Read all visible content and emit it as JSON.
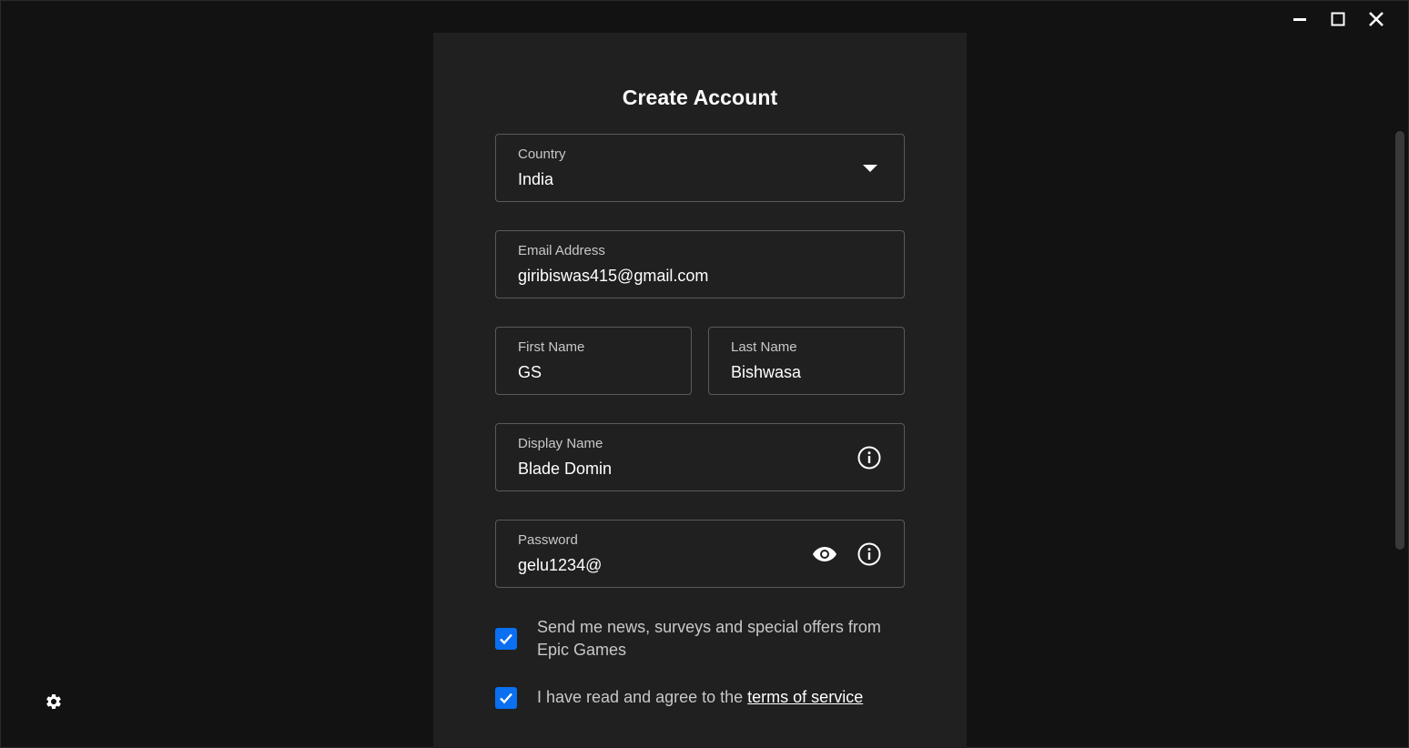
{
  "form": {
    "title": "Create Account",
    "country": {
      "label": "Country",
      "value": "India"
    },
    "email": {
      "label": "Email Address",
      "value": "giribiswas415@gmail.com"
    },
    "first_name": {
      "label": "First Name",
      "value": "GS"
    },
    "last_name": {
      "label": "Last Name",
      "value": "Bishwasa"
    },
    "display_name": {
      "label": "Display Name",
      "value": "Blade Domin"
    },
    "password": {
      "label": "Password",
      "value": "gelu1234@"
    },
    "news_opt_in": {
      "checked": true,
      "text": "Send me news, surveys and special offers from Epic Games"
    },
    "tos": {
      "checked": true,
      "text": "I have read and agree to the ",
      "link": "terms of service"
    }
  },
  "icons": {
    "window": [
      "minimize-icon",
      "maximize-icon",
      "close-icon"
    ],
    "settings": "gear-icon",
    "dropdown": "caret-down-icon",
    "info": "info-icon",
    "show_password": "eye-icon",
    "checkbox": "checkmark-icon"
  },
  "colors": {
    "background": "#121212",
    "panel": "#202020",
    "accent": "#0a6ff0",
    "border": "#5a5a5a"
  }
}
